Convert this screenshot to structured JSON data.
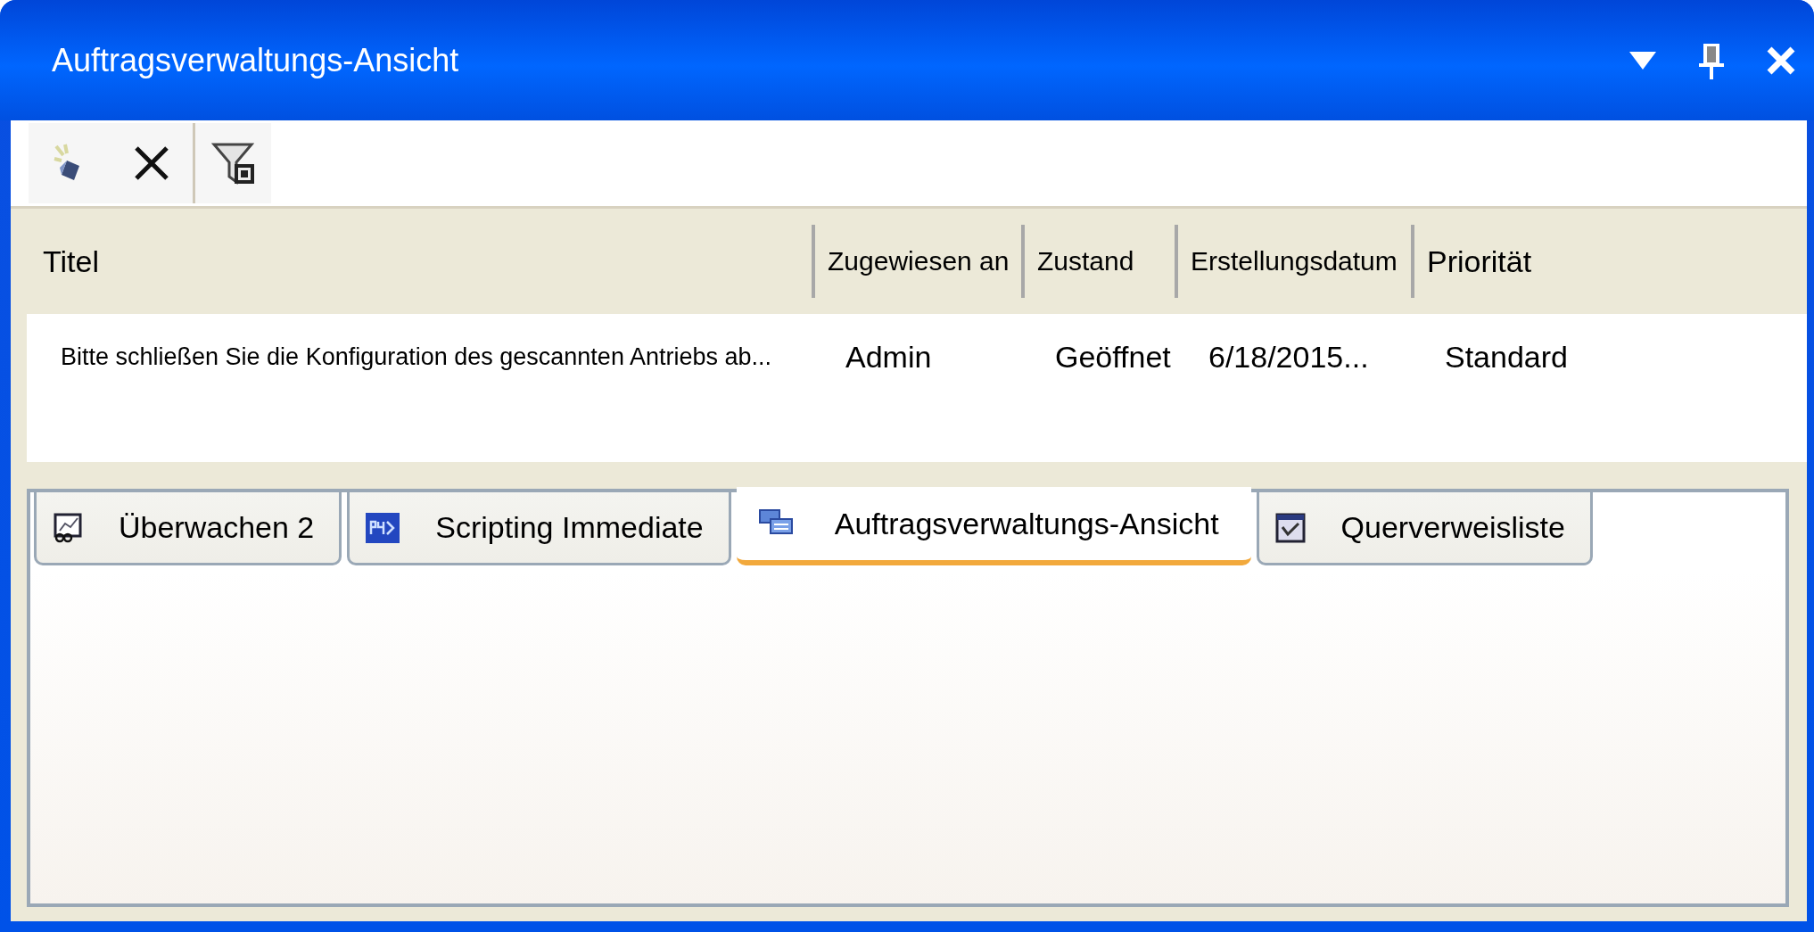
{
  "window": {
    "title": "Auftragsverwaltungs-Ansicht"
  },
  "table": {
    "columns": [
      "Titel",
      "Zugewiesen an",
      "Zustand",
      "Erstellungsdatum",
      "Priorität"
    ],
    "rows": [
      {
        "cells": [
          "Bitte schließen Sie die Konfiguration des gescannten Antriebs ab...",
          "Admin",
          "Geöffnet",
          "6/18/2015...",
          "Standard"
        ]
      }
    ]
  },
  "tabs": [
    {
      "label": "Überwachen 2",
      "kind": "monitor",
      "selected": false
    },
    {
      "label": "Scripting Immediate",
      "kind": "script",
      "selected": false
    },
    {
      "label": "Auftragsverwaltungs-Ansicht",
      "kind": "tasks",
      "selected": true
    },
    {
      "label": "Querverweisliste",
      "kind": "crossref",
      "selected": false
    }
  ]
}
